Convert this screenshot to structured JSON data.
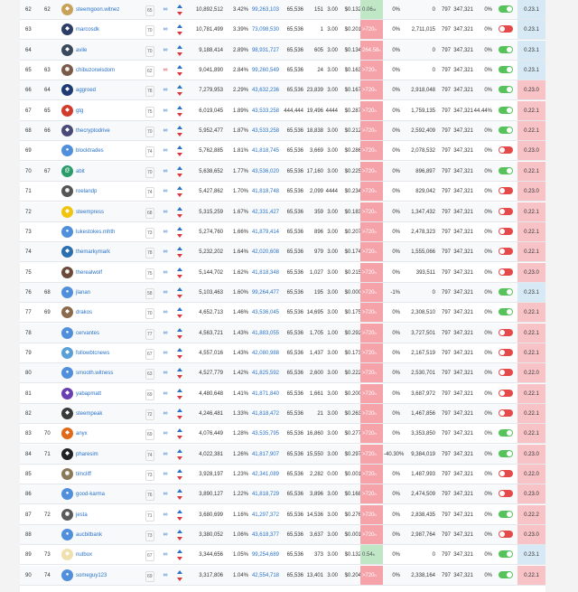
{
  "witnesses": [
    {
      "rank": "62",
      "prev": "62",
      "name": "steemgoon.witnez",
      "rep": "65",
      "link_status": "ok",
      "votes": "10,892,512",
      "percent": "3.42%",
      "mvests": "99,263,103",
      "base": "65,536",
      "m1": "151",
      "m2": "3.00",
      "price": "$0.132",
      "missed": "0.06",
      "missed_suffix": "/d",
      "missed_color": "green",
      "missed_pct": "0%",
      "blocks": "0",
      "ver2": "797",
      "last": "347,321",
      "fee": "0%",
      "enabled": true,
      "version": "0.23.1",
      "version_color": "blue",
      "avatar_color": "#c9a25a",
      "avatar_icon": "logo"
    },
    {
      "rank": "63",
      "prev": "",
      "name": "marcosdk",
      "rep": "70",
      "link_status": "ok",
      "votes": "10,781,499",
      "percent": "3.39%",
      "mvests": "73,098,530",
      "base": "65,536",
      "m1": "1",
      "m2": "3.00",
      "price": "$0.201",
      "missed": ">720",
      "missed_suffix": "h",
      "missed_color": "red",
      "missed_pct": "0%",
      "blocks": "2,711,015",
      "ver2": "797",
      "last": "347,321",
      "fee": "0%",
      "enabled": false,
      "version": "0.23.1",
      "version_color": "blue",
      "avatar_color": "#2c3e66",
      "avatar_icon": "logo"
    },
    {
      "rank": "64",
      "prev": "",
      "name": "avile",
      "rep": "70",
      "link_status": "ok",
      "votes": "9,188,414",
      "percent": "2.89%",
      "mvests": "98,931,727",
      "base": "65,536",
      "m1": "605",
      "m2": "3.00",
      "price": "$0.134",
      "missed": "264.58",
      "missed_suffix": "h",
      "missed_color": "red",
      "missed_pct": "0%",
      "blocks": "0",
      "ver2": "797",
      "last": "347,321",
      "fee": "0%",
      "enabled": true,
      "version": "0.23.1",
      "version_color": "blue",
      "avatar_color": "#3a4a5c",
      "avatar_icon": "logo"
    },
    {
      "rank": "65",
      "prev": "63",
      "name": "chibuzorwisdom",
      "rep": "62",
      "link_status": "bad",
      "votes": "9,041,890",
      "percent": "2.84%",
      "mvests": "99,260,549",
      "base": "65,536",
      "m1": "24",
      "m2": "3.00",
      "price": "$0.163",
      "missed": ">720",
      "missed_suffix": "h",
      "missed_color": "red",
      "missed_pct": "0%",
      "blocks": "0",
      "ver2": "797",
      "last": "347,321",
      "fee": "0%",
      "enabled": true,
      "version": "0.23.1",
      "version_color": "blue",
      "avatar_color": "#7a5a48",
      "avatar_icon": "photo"
    },
    {
      "rank": "66",
      "prev": "64",
      "name": "aggroed",
      "rep": "78",
      "link_status": "ok",
      "votes": "7,279,953",
      "percent": "2.29%",
      "mvests": "43,632,236",
      "base": "65,536",
      "m1": "23,839",
      "m2": "3.00",
      "price": "$0.167",
      "missed": ">720",
      "missed_suffix": "h",
      "missed_color": "red",
      "missed_pct": "0%",
      "blocks": "2,918,048",
      "ver2": "797",
      "last": "347,321",
      "fee": "0%",
      "enabled": true,
      "version": "0.23.0",
      "version_color": "pink",
      "avatar_color": "#1f3b73",
      "avatar_icon": "logo"
    },
    {
      "rank": "67",
      "prev": "65",
      "name": "gtg",
      "rep": "75",
      "link_status": "ok",
      "votes": "6,019,045",
      "percent": "1.89%",
      "mvests": "43,533,258",
      "base": "444,444",
      "m1": "19,496",
      "m2": "4444",
      "price": "$0.287",
      "missed": ">720",
      "missed_suffix": "h",
      "missed_color": "red",
      "missed_pct": "0%",
      "blocks": "1,759,135",
      "ver2": "797",
      "last": "347,321",
      "fee": "44.44%",
      "enabled": true,
      "version": "0.22.1",
      "version_color": "pink",
      "avatar_color": "#d23a2b",
      "avatar_icon": "logo"
    },
    {
      "rank": "68",
      "prev": "66",
      "name": "thecryptodrive",
      "rep": "70",
      "link_status": "ok",
      "votes": "5,952,477",
      "percent": "1.87%",
      "mvests": "43,533,258",
      "base": "65,536",
      "m1": "18,838",
      "m2": "3.00",
      "price": "$0.212",
      "missed": ">720",
      "missed_suffix": "h",
      "missed_color": "red",
      "missed_pct": "0%",
      "blocks": "2,592,409",
      "ver2": "797",
      "last": "347,321",
      "fee": "0%",
      "enabled": true,
      "version": "0.22.1",
      "version_color": "pink",
      "avatar_color": "#4a4a78",
      "avatar_icon": "logo"
    },
    {
      "rank": "69",
      "prev": "",
      "name": "blocktrades",
      "rep": "74",
      "link_status": "ok",
      "votes": "5,762,885",
      "percent": "1.81%",
      "mvests": "41,818,745",
      "base": "65,536",
      "m1": "3,669",
      "m2": "3.00",
      "price": "$0.286",
      "missed": ">720",
      "missed_suffix": "h",
      "missed_color": "red",
      "missed_pct": "0%",
      "blocks": "2,078,532",
      "ver2": "797",
      "last": "347,321",
      "fee": "0%",
      "enabled": false,
      "version": "0.23.0",
      "version_color": "pink",
      "avatar_color": "#4f8fdc",
      "avatar_icon": "user"
    },
    {
      "rank": "70",
      "prev": "67",
      "name": "abit",
      "rep": "70",
      "link_status": "ok",
      "votes": "5,638,652",
      "percent": "1.77%",
      "mvests": "43,536,020",
      "base": "65,536",
      "m1": "17,160",
      "m2": "3.00",
      "price": "$0.225",
      "missed": ">720",
      "missed_suffix": "h",
      "missed_color": "red",
      "missed_pct": "0%",
      "blocks": "896,897",
      "ver2": "797",
      "last": "347,321",
      "fee": "0%",
      "enabled": true,
      "version": "0.22.1",
      "version_color": "pink",
      "avatar_color": "#2a9c6a",
      "avatar_icon": "at"
    },
    {
      "rank": "71",
      "prev": "",
      "name": "roelandp",
      "rep": "74",
      "link_status": "ok",
      "votes": "5,427,862",
      "percent": "1.70%",
      "mvests": "41,818,748",
      "base": "65,536",
      "m1": "2,099",
      "m2": "4444",
      "price": "$0.234",
      "missed": ">720",
      "missed_suffix": "h",
      "missed_color": "red",
      "missed_pct": "0%",
      "blocks": "829,042",
      "ver2": "797",
      "last": "347,321",
      "fee": "0%",
      "enabled": false,
      "version": "0.23.0",
      "version_color": "pink",
      "avatar_color": "#555555",
      "avatar_icon": "photo"
    },
    {
      "rank": "72",
      "prev": "",
      "name": "steempress",
      "rep": "68",
      "link_status": "ok",
      "votes": "5,315,259",
      "percent": "1.67%",
      "mvests": "42,331,427",
      "base": "65,536",
      "m1": "359",
      "m2": "3.00",
      "price": "$0.183",
      "missed": ">720",
      "missed_suffix": "h",
      "missed_color": "red",
      "missed_pct": "0%",
      "blocks": "1,347,432",
      "ver2": "797",
      "last": "347,321",
      "fee": "0%",
      "enabled": false,
      "version": "0.22.1",
      "version_color": "pink",
      "avatar_color": "#f1c40f",
      "avatar_icon": "logo"
    },
    {
      "rank": "73",
      "prev": "",
      "name": "lukestokes.mhth",
      "rep": "73",
      "link_status": "ok",
      "votes": "5,274,760",
      "percent": "1.66%",
      "mvests": "41,879,414",
      "base": "65,536",
      "m1": "896",
      "m2": "3.00",
      "price": "$0.207",
      "missed": ">720",
      "missed_suffix": "h",
      "missed_color": "red",
      "missed_pct": "0%",
      "blocks": "2,478,323",
      "ver2": "797",
      "last": "347,321",
      "fee": "0%",
      "enabled": false,
      "version": "0.22.1",
      "version_color": "pink",
      "avatar_color": "#4f8fdc",
      "avatar_icon": "user"
    },
    {
      "rank": "74",
      "prev": "",
      "name": "themarkymark",
      "rep": "78",
      "link_status": "ok",
      "votes": "5,232,202",
      "percent": "1.64%",
      "mvests": "42,020,608",
      "base": "65,536",
      "m1": "979",
      "m2": "3.00",
      "price": "$0.174",
      "missed": ">720",
      "missed_suffix": "h",
      "missed_color": "red",
      "missed_pct": "0%",
      "blocks": "1,555,066",
      "ver2": "797",
      "last": "347,321",
      "fee": "0%",
      "enabled": false,
      "version": "0.22.1",
      "version_color": "pink",
      "avatar_color": "#2a6fb0",
      "avatar_icon": "logo"
    },
    {
      "rank": "75",
      "prev": "",
      "name": "therealwolf",
      "rep": "75",
      "link_status": "ok",
      "votes": "5,144,702",
      "percent": "1.62%",
      "mvests": "41,818,348",
      "base": "65,536",
      "m1": "1,027",
      "m2": "3.00",
      "price": "$0.215",
      "missed": ">720",
      "missed_suffix": "h",
      "missed_color": "red",
      "missed_pct": "0%",
      "blocks": "393,511",
      "ver2": "797",
      "last": "347,321",
      "fee": "0%",
      "enabled": false,
      "version": "0.23.0",
      "version_color": "pink",
      "avatar_color": "#6b4a3a",
      "avatar_icon": "photo"
    },
    {
      "rank": "76",
      "prev": "68",
      "name": "jlanan",
      "rep": "58",
      "link_status": "ok",
      "votes": "5,103,463",
      "percent": "1.60%",
      "mvests": "99,264,477",
      "base": "65,536",
      "m1": "195",
      "m2": "3.00",
      "price": "$0.000",
      "missed": ">720",
      "missed_suffix": "h",
      "missed_color": "red",
      "missed_pct": "-1%",
      "blocks": "0",
      "ver2": "797",
      "last": "347,321",
      "fee": "0%",
      "enabled": true,
      "version": "0.23.1",
      "version_color": "blue",
      "avatar_color": "#4f8fdc",
      "avatar_icon": "user"
    },
    {
      "rank": "77",
      "prev": "69",
      "name": "drakos",
      "rep": "70",
      "link_status": "ok",
      "votes": "4,652,713",
      "percent": "1.46%",
      "mvests": "43,536,045",
      "base": "65,536",
      "m1": "14,695",
      "m2": "3.00",
      "price": "$0.175",
      "missed": ">720",
      "missed_suffix": "h",
      "missed_color": "red",
      "missed_pct": "0%",
      "blocks": "2,308,510",
      "ver2": "797",
      "last": "347,321",
      "fee": "0%",
      "enabled": true,
      "version": "0.22.1",
      "version_color": "pink",
      "avatar_color": "#8a6a4a",
      "avatar_icon": "logo"
    },
    {
      "rank": "78",
      "prev": "",
      "name": "cervantes",
      "rep": "77",
      "link_status": "ok",
      "votes": "4,563,721",
      "percent": "1.43%",
      "mvests": "41,883,055",
      "base": "65,536",
      "m1": "1,705",
      "m2": "1.00",
      "price": "$0.292",
      "missed": ">720",
      "missed_suffix": "h",
      "missed_color": "red",
      "missed_pct": "0%",
      "blocks": "3,727,501",
      "ver2": "797",
      "last": "347,321",
      "fee": "0%",
      "enabled": false,
      "version": "0.22.1",
      "version_color": "pink",
      "avatar_color": "#4f8fdc",
      "avatar_icon": "user"
    },
    {
      "rank": "79",
      "prev": "",
      "name": "followbtcnews",
      "rep": "67",
      "link_status": "ok",
      "votes": "4,557,016",
      "percent": "1.43%",
      "mvests": "42,080,988",
      "base": "65,536",
      "m1": "1,437",
      "m2": "3.00",
      "price": "$0.173",
      "missed": ">720",
      "missed_suffix": "h",
      "missed_color": "red",
      "missed_pct": "0%",
      "blocks": "2,167,519",
      "ver2": "797",
      "last": "347,321",
      "fee": "0%",
      "enabled": false,
      "version": "0.22.1",
      "version_color": "pink",
      "avatar_color": "#5aa0d8",
      "avatar_icon": "logo"
    },
    {
      "rank": "80",
      "prev": "",
      "name": "smooth.witness",
      "rep": "63",
      "link_status": "ok",
      "votes": "4,527,779",
      "percent": "1.42%",
      "mvests": "41,825,592",
      "base": "65,536",
      "m1": "2,600",
      "m2": "3.00",
      "price": "$0.222",
      "missed": ">720",
      "missed_suffix": "h",
      "missed_color": "red",
      "missed_pct": "0%",
      "blocks": "2,530,701",
      "ver2": "797",
      "last": "347,321",
      "fee": "0%",
      "enabled": false,
      "version": "0.22.0",
      "version_color": "pink",
      "avatar_color": "#4f8fdc",
      "avatar_icon": "user"
    },
    {
      "rank": "81",
      "prev": "",
      "name": "yabapmatt",
      "rep": "69",
      "link_status": "ok",
      "votes": "4,480,648",
      "percent": "1.41%",
      "mvests": "41,871,840",
      "base": "65,536",
      "m1": "1,661",
      "m2": "3.00",
      "price": "$0.200",
      "missed": ">720",
      "missed_suffix": "h",
      "missed_color": "red",
      "missed_pct": "0%",
      "blocks": "3,687,972",
      "ver2": "797",
      "last": "347,321",
      "fee": "0%",
      "enabled": false,
      "version": "0.22.1",
      "version_color": "pink",
      "avatar_color": "#6a3fb0",
      "avatar_icon": "logo"
    },
    {
      "rank": "82",
      "prev": "",
      "name": "steempeak",
      "rep": "72",
      "link_status": "ok",
      "votes": "4,246,481",
      "percent": "1.33%",
      "mvests": "41,818,472",
      "base": "65,536",
      "m1": "21",
      "m2": "3.00",
      "price": "$0.263",
      "missed": ">720",
      "missed_suffix": "h",
      "missed_color": "red",
      "missed_pct": "0%",
      "blocks": "1,467,856",
      "ver2": "797",
      "last": "347,321",
      "fee": "0%",
      "enabled": false,
      "version": "0.22.1",
      "version_color": "pink",
      "avatar_color": "#3a3a3a",
      "avatar_icon": "logo"
    },
    {
      "rank": "83",
      "prev": "70",
      "name": "anyx",
      "rep": "69",
      "link_status": "ok",
      "votes": "4,076,449",
      "percent": "1.28%",
      "mvests": "43,535,795",
      "base": "65,536",
      "m1": "16,860",
      "m2": "3.00",
      "price": "$0.277",
      "missed": ">720",
      "missed_suffix": "h",
      "missed_color": "red",
      "missed_pct": "0%",
      "blocks": "3,353,850",
      "ver2": "797",
      "last": "347,321",
      "fee": "0%",
      "enabled": true,
      "version": "0.22.1",
      "version_color": "pink",
      "avatar_color": "#e06a1a",
      "avatar_icon": "logo"
    },
    {
      "rank": "84",
      "prev": "71",
      "name": "pharesim",
      "rep": "74",
      "link_status": "ok",
      "votes": "4,022,381",
      "percent": "1.26%",
      "mvests": "41,817,907",
      "base": "65,536",
      "m1": "15,550",
      "m2": "3.00",
      "price": "$0.297",
      "missed": ">720",
      "missed_suffix": "h",
      "missed_color": "red",
      "missed_pct": "-40.30%",
      "blocks": "9,384,019",
      "ver2": "797",
      "last": "347,321",
      "fee": "0%",
      "enabled": true,
      "version": "0.23.0",
      "version_color": "pink",
      "avatar_color": "#222222",
      "avatar_icon": "logo"
    },
    {
      "rank": "85",
      "prev": "",
      "name": "timcliff",
      "rep": "73",
      "link_status": "ok",
      "votes": "3,928,197",
      "percent": "1.23%",
      "mvests": "42,341,089",
      "base": "65,536",
      "m1": "2,282",
      "m2": "0.00",
      "price": "$0.001",
      "missed": ">720",
      "missed_suffix": "h",
      "missed_color": "red",
      "missed_pct": "0%",
      "blocks": "1,487,993",
      "ver2": "797",
      "last": "347,321",
      "fee": "0%",
      "enabled": false,
      "version": "0.22.0",
      "version_color": "pink",
      "avatar_color": "#8a7a5a",
      "avatar_icon": "photo"
    },
    {
      "rank": "86",
      "prev": "",
      "name": "good-karma",
      "rep": "76",
      "link_status": "ok",
      "votes": "3,890,127",
      "percent": "1.22%",
      "mvests": "41,818,729",
      "base": "65,536",
      "m1": "3,896",
      "m2": "3.00",
      "price": "$0.168",
      "missed": ">720",
      "missed_suffix": "h",
      "missed_color": "red",
      "missed_pct": "0%",
      "blocks": "2,474,509",
      "ver2": "797",
      "last": "347,321",
      "fee": "0%",
      "enabled": false,
      "version": "0.23.0",
      "version_color": "pink",
      "avatar_color": "#4f8fdc",
      "avatar_icon": "user"
    },
    {
      "rank": "87",
      "prev": "72",
      "name": "jesta",
      "rep": "71",
      "link_status": "ok",
      "votes": "3,680,699",
      "percent": "1.16%",
      "mvests": "41,297,372",
      "base": "65,536",
      "m1": "14,536",
      "m2": "3.00",
      "price": "$0.276",
      "missed": ">720",
      "missed_suffix": "h",
      "missed_color": "red",
      "missed_pct": "0%",
      "blocks": "2,838,435",
      "ver2": "797",
      "last": "347,321",
      "fee": "0%",
      "enabled": true,
      "version": "0.22.2",
      "version_color": "pink",
      "avatar_color": "#5a5a5a",
      "avatar_icon": "photo"
    },
    {
      "rank": "88",
      "prev": "",
      "name": "aucbitbank",
      "rep": "73",
      "link_status": "ok",
      "votes": "3,380,052",
      "percent": "1.06%",
      "mvests": "43,618,377",
      "base": "65,536",
      "m1": "3,637",
      "m2": "3.00",
      "price": "$0.001",
      "missed": ">720",
      "missed_suffix": "h",
      "missed_color": "red",
      "missed_pct": "0%",
      "blocks": "2,987,764",
      "ver2": "797",
      "last": "347,321",
      "fee": "0%",
      "enabled": false,
      "version": "0.23.0",
      "version_color": "pink",
      "avatar_color": "#4f8fdc",
      "avatar_icon": "user"
    },
    {
      "rank": "89",
      "prev": "73",
      "name": "nutbox",
      "rep": "67",
      "link_status": "ok",
      "votes": "3,344,656",
      "percent": "1.05%",
      "mvests": "99,254,689",
      "base": "65,536",
      "m1": "373",
      "m2": "3.00",
      "price": "$0.132",
      "missed": "0.54",
      "missed_suffix": "h",
      "missed_color": "green",
      "missed_pct": "0%",
      "blocks": "0",
      "ver2": "797",
      "last": "347,321",
      "fee": "0%",
      "enabled": true,
      "version": "0.23.1",
      "version_color": "blue",
      "avatar_color": "#f0e0b0",
      "avatar_icon": "logo"
    },
    {
      "rank": "90",
      "prev": "74",
      "name": "someguy123",
      "rep": "69",
      "link_status": "ok",
      "votes": "3,317,806",
      "percent": "1.04%",
      "mvests": "42,554,718",
      "base": "65,536",
      "m1": "13,401",
      "m2": "3.00",
      "price": "$0.204",
      "missed": ">720",
      "missed_suffix": "h",
      "missed_color": "red",
      "missed_pct": "0%",
      "blocks": "2,338,164",
      "ver2": "797",
      "last": "347,321",
      "fee": "0%",
      "enabled": true,
      "version": "0.22.1",
      "version_color": "pink",
      "avatar_color": "#4f8fdc",
      "avatar_icon": "user"
    }
  ],
  "colors": {
    "link_blue": "#2a73c9",
    "toggle_on": "#56c35a",
    "toggle_off": "#e44a4a",
    "missed_red": "#f5a3a9",
    "missed_green": "#bfe7c6",
    "version_blue": "#d8e9f6",
    "version_pink": "#f8c3c6"
  }
}
